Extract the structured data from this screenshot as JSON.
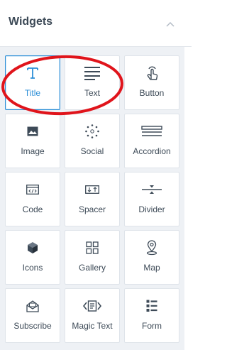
{
  "panel": {
    "title": "Widgets",
    "collapse_icon": "chevron-up-icon"
  },
  "colors": {
    "accent": "#2d8fd7",
    "text": "#3d4a57",
    "grid_bg": "#eef1f5",
    "annotation": "#e0141b"
  },
  "widgets": [
    {
      "label": "Title",
      "icon": "title-icon",
      "selected": true
    },
    {
      "label": "Text",
      "icon": "text-lines-icon"
    },
    {
      "label": "Button",
      "icon": "tap-finger-icon"
    },
    {
      "label": "Image",
      "icon": "image-icon"
    },
    {
      "label": "Social",
      "icon": "social-dots-icon"
    },
    {
      "label": "Accordion",
      "icon": "accordion-icon"
    },
    {
      "label": "Code",
      "icon": "code-icon"
    },
    {
      "label": "Spacer",
      "icon": "spacer-icon"
    },
    {
      "label": "Divider",
      "icon": "divider-icon"
    },
    {
      "label": "Icons",
      "icon": "cube-icon"
    },
    {
      "label": "Gallery",
      "icon": "gallery-grid-icon"
    },
    {
      "label": "Map",
      "icon": "map-pin-icon"
    },
    {
      "label": "Subscribe",
      "icon": "envelope-icon"
    },
    {
      "label": "Magic Text",
      "icon": "magic-text-icon"
    },
    {
      "label": "Form",
      "icon": "form-list-icon"
    }
  ]
}
